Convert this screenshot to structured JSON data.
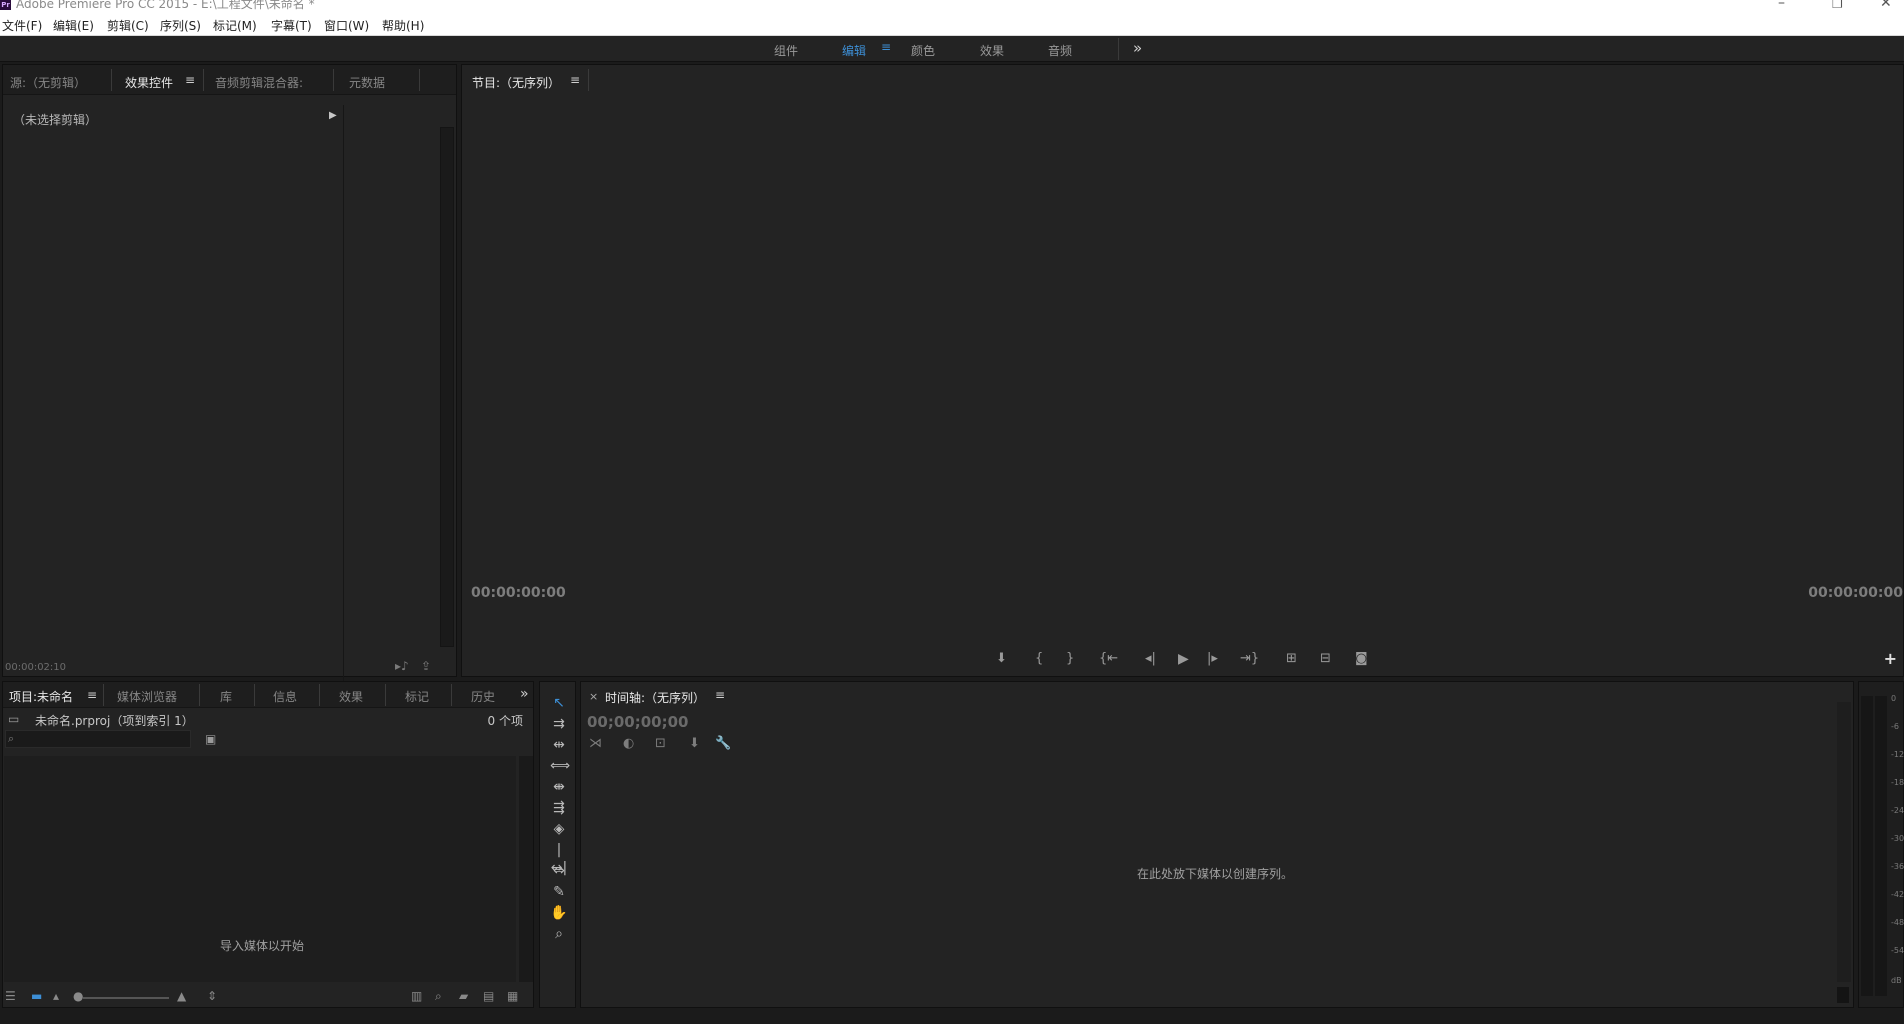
{
  "window": {
    "title": "Adobe Premiere Pro CC 2015 - E:\\工程文件\\未命名 *",
    "logo": "Pr"
  },
  "menubar": {
    "items": [
      "文件(F)",
      "编辑(E)",
      "剪辑(C)",
      "序列(S)",
      "标记(M)",
      "字幕(T)",
      "窗口(W)",
      "帮助(H)"
    ]
  },
  "workspaces": {
    "items": [
      "组件",
      "编辑",
      "颜色",
      "效果",
      "音频"
    ],
    "active": "编辑",
    "menu_icon": "≡",
    "more": "»"
  },
  "effect_panel": {
    "tabs": [
      "源:（无剪辑）",
      "效果控件",
      "音频剪辑混合器:",
      "元数据"
    ],
    "active_tab": "效果控件",
    "menu_icon": "≡",
    "no_clip": "（未选择剪辑）",
    "timecode": "00:00:02:10"
  },
  "program_panel": {
    "tab": "节目:（无序列）",
    "menu_icon": "≡",
    "timecode_left": "00:00:00:00",
    "timecode_right": "00:00:00:00",
    "controls": [
      "marker-icon",
      "mark-in-icon",
      "mark-out-icon",
      "go-to-in-icon",
      "step-back-icon",
      "play-icon",
      "step-forward-icon",
      "go-to-out-icon",
      "lift-icon",
      "extract-icon",
      "export-frame-icon"
    ],
    "add": "+"
  },
  "project_panel": {
    "tabs": [
      "项目:未命名",
      "媒体浏览器",
      "库",
      "信息",
      "效果",
      "标记",
      "历史"
    ],
    "active_tab": "项目:未命名",
    "menu_icon": "≡",
    "more": "»",
    "project_file": "未命名.prproj（项到索引 1）",
    "item_count": "0 个项",
    "search_placeholder": "",
    "empty_message": "导入媒体以开始"
  },
  "timeline_panel": {
    "close": "×",
    "tab": "时间轴:（无序列）",
    "menu_icon": "≡",
    "timecode": "00;00;00;00",
    "drop_message": "在此处放下媒体以创建序列。"
  },
  "meters": {
    "labels": [
      "0",
      "-6",
      "-12",
      "-18",
      "-24",
      "-30",
      "-36",
      "-42",
      "-48",
      "-54",
      "dB"
    ]
  },
  "colors": {
    "accent": "#3d8fd6",
    "panel_bg": "#232323",
    "app_bg": "#1b1b1b"
  }
}
